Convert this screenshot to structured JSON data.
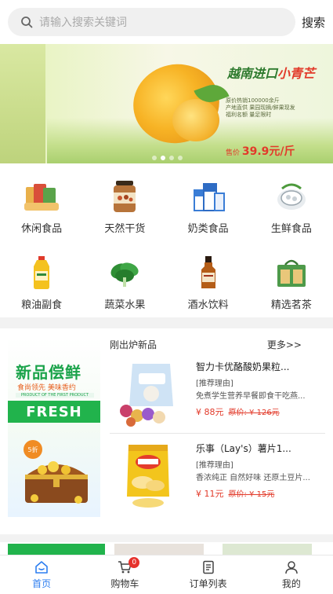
{
  "search": {
    "placeholder": "请输入搜索关键词",
    "button_label": "搜索",
    "icon": "search-icon"
  },
  "banner": {
    "title_green": "越南进口",
    "title_red": "小青芒",
    "desc_lines": [
      "原价热销100000余斤",
      "产地直供 果园现摘/鲜果现发",
      "福利名额 量足限时"
    ],
    "price_label": "售价 ",
    "price_value": "39.9元/斤",
    "slide_count": 4,
    "active_slide": 2
  },
  "categories": [
    {
      "label": "休闲食品",
      "icon": "snack-icon"
    },
    {
      "label": "天然干货",
      "icon": "nuts-jar-icon"
    },
    {
      "label": "奶类食品",
      "icon": "milk-icon"
    },
    {
      "label": "生鲜食品",
      "icon": "fresh-food-icon"
    },
    {
      "label": "粮油副食",
      "icon": "oil-bottle-icon"
    },
    {
      "label": "蔬菜水果",
      "icon": "vegetable-icon"
    },
    {
      "label": "酒水饮料",
      "icon": "liquor-icon"
    },
    {
      "label": "精选茗茶",
      "icon": "tea-box-icon"
    }
  ],
  "promo": {
    "headline": "新品偿鲜",
    "tagline": "食尚领先 美味香约",
    "small": "PRODUCT OF THE FIRST PRODUCT",
    "fresh": "FRESH",
    "badge": "5折"
  },
  "new_section": {
    "title": "刚出炉新品",
    "more": "更多>>"
  },
  "products": [
    {
      "name": "智力卡优酪酸奶果粒...",
      "reason": "[推荐理由]",
      "sub": "免煮学生营养早餐即食干吃燕...",
      "price": "¥ 88元",
      "old_price": "原价: ¥ 126元",
      "icon": "yogurt-cereal-icon"
    },
    {
      "name": "乐事（Lay's）薯片1...",
      "reason": "[推荐理由]",
      "sub": "香浓纯正 自然好味 还原土豆片...",
      "price": "¥ 11元",
      "old_price": "原价: ¥ 15元",
      "icon": "chips-bag-icon"
    }
  ],
  "tabs": [
    {
      "label": "首页",
      "icon": "home-icon",
      "active": true
    },
    {
      "label": "购物车",
      "icon": "cart-icon",
      "badge": "0"
    },
    {
      "label": "订单列表",
      "icon": "order-list-icon"
    },
    {
      "label": "我的",
      "icon": "user-icon"
    }
  ],
  "colors": {
    "accent": "#2d7ef0",
    "price_red": "#e23a2a",
    "fresh_green": "#21b34c",
    "badge_red": "#e6322c"
  }
}
